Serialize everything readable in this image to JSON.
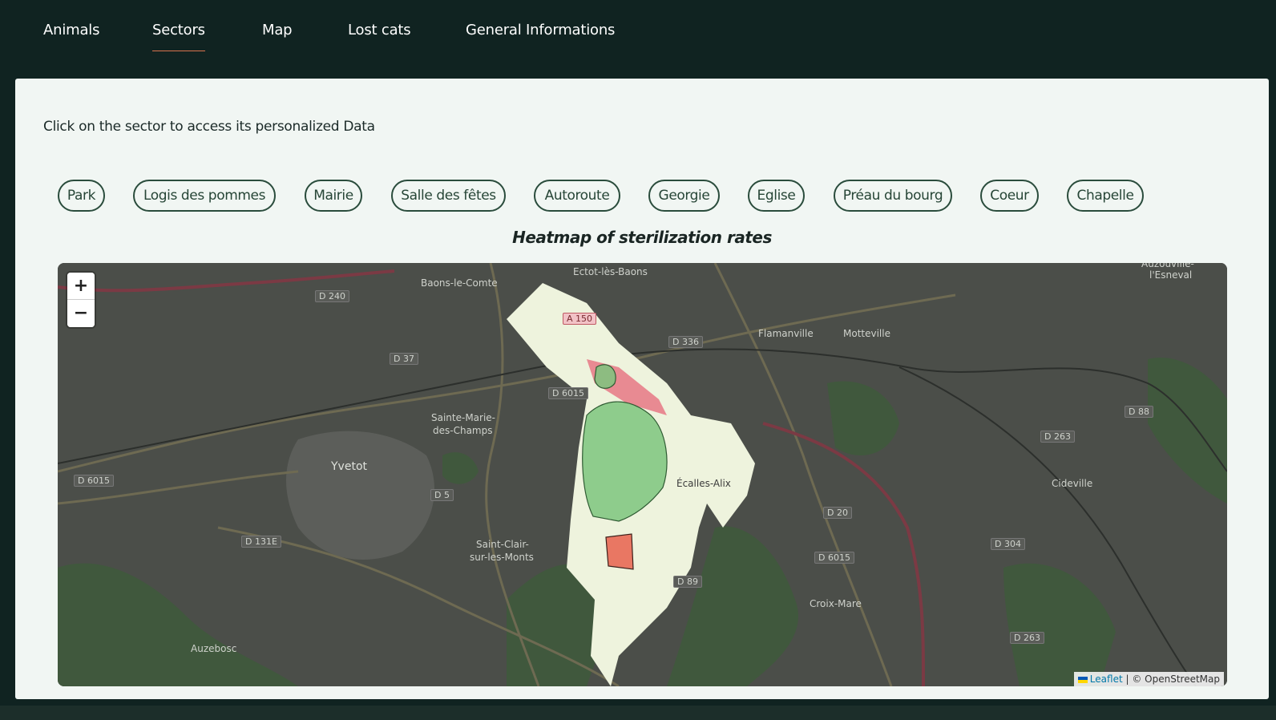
{
  "nav": {
    "items": [
      {
        "label": "Animals",
        "active": false
      },
      {
        "label": "Sectors",
        "active": true
      },
      {
        "label": "Map",
        "active": false
      },
      {
        "label": "Lost cats",
        "active": false
      },
      {
        "label": "General Informations",
        "active": false
      }
    ]
  },
  "main": {
    "instruction": "Click on the sector to access its personalized Data",
    "sectors": [
      "Park",
      "Logis des pommes",
      "Mairie",
      "Salle des fêtes",
      "Autoroute",
      "Georgie",
      "Eglise",
      "Préau du bourg",
      "Coeur",
      "Chapelle"
    ],
    "heading": "Heatmap of sterilization rates"
  },
  "map": {
    "zoom_in_label": "+",
    "zoom_out_label": "−",
    "attribution": {
      "leaflet_label": "Leaflet",
      "osm_label": "| © OpenStreetMap"
    },
    "places": [
      "Ectot-lès-Baons",
      "Baons-le-Comte",
      "Flamanville",
      "Motteville",
      "Sainte-Marie-",
      "des-Champs",
      "Yvetot",
      "Saint-Clair-",
      "sur-les-Monts",
      "Écalles-Alix",
      "Cideville",
      "Croix-Mare",
      "Auzebosc",
      "Auzouville-",
      "l'Esneval"
    ],
    "roads": [
      "A 150",
      "D 240",
      "D 37",
      "D 6015",
      "D 336",
      "D 88",
      "D 263",
      "D 5",
      "D 131E",
      "D 20",
      "D 304",
      "D 89",
      "D 6015",
      "D 6015",
      "D 263"
    ],
    "heat_colors": {
      "low": "#e8705c",
      "high": "#7cc47e"
    }
  }
}
